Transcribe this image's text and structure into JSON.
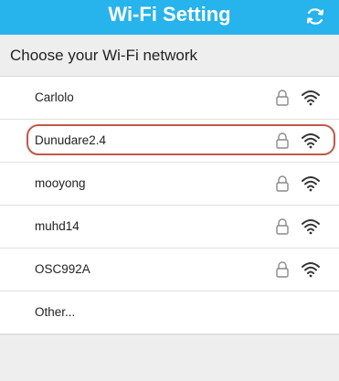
{
  "header": {
    "title": "Wi-Fi Setting",
    "refresh_icon": "refresh-icon",
    "background": "#27b3ec"
  },
  "subheader": {
    "text": "Choose your Wi-Fi network"
  },
  "networks": [
    {
      "name": "Carlolo",
      "secured": true,
      "selected": false
    },
    {
      "name": "Dunudare2.4",
      "secured": true,
      "selected": true
    },
    {
      "name": "mooyong",
      "secured": true,
      "selected": false
    },
    {
      "name": "muhd14",
      "secured": true,
      "selected": false
    },
    {
      "name": "OSC992A",
      "secured": true,
      "selected": false
    }
  ],
  "other": {
    "label": "Other..."
  },
  "colors": {
    "selection_ring": "#c0584a"
  }
}
